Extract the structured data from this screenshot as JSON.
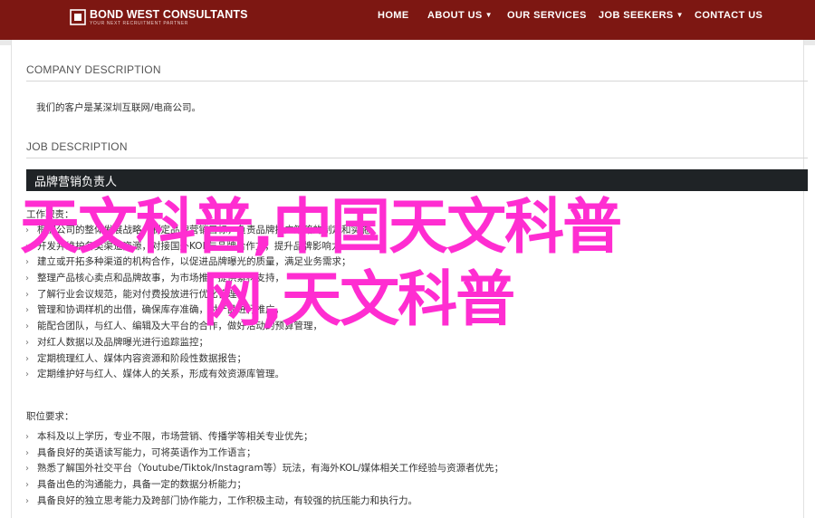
{
  "header": {
    "brand_name": "BOND WEST CONSULTANTS",
    "brand_tagline": "YOUR NEXT RECRUITMENT PARTNER",
    "nav": [
      {
        "label": "HOME",
        "dropdown": false
      },
      {
        "label": "ABOUT US",
        "dropdown": true
      },
      {
        "label": "OUR SERVICES",
        "dropdown": false
      },
      {
        "label": "JOB SEEKERS",
        "dropdown": true
      },
      {
        "label": "CONTACT US",
        "dropdown": false
      }
    ]
  },
  "company": {
    "heading": "COMPANY DESCRIPTION",
    "text": "我们的客户是某深圳互联网/电商公司。"
  },
  "job": {
    "heading": "JOB DESCRIPTION",
    "title": "品牌营销负责人",
    "duties_heading": "工作职责：",
    "duties": [
      "根据公司的整体发展战略，制定品牌营销目标，负责品牌推广策略的制定和实施",
      "开发并维护各类渠道资源，对接国外KOL与品牌合作方，提升品牌影响力",
      "建立或开拓多种渠道的机构合作，以促进品牌曝光的质量，满足业务需求；",
      "整理产品核心卖点和品牌故事，为市场推广提供素材支持，",
      "了解行业会议规范，能对付费投放进行优化管理，",
      "管理和协调样机的出借，确保库存准确，对产品进行推广，",
      "能配合团队，与红人、编辑及大平台的合作，做好活动的预算管理，",
      "对红人数据以及品牌曝光进行追踪监控；",
      "定期梳理红人、媒体内容资源和阶段性数据报告；",
      "定期维护好与红人、媒体人的关系，形成有效资源库管理。"
    ],
    "requirements_heading": "职位要求：",
    "requirements": [
      "本科及以上学历，专业不限，市场营销、传播学等相关专业优先；",
      "具备良好的英语读写能力，可将英语作为工作语言；",
      "熟悉了解国外社交平台（Youtube/Tiktok/Instagram等）玩法，有海外KOL/媒体相关工作经验与资源者优先；",
      "具备出色的沟通能力，具备一定的数据分析能力；",
      "具备良好的独立思考能力及跨部门协作能力，工作积极主动，有较强的抗压能力和执行力。"
    ]
  },
  "watermark": {
    "line1": "天文科普,中国天文科普",
    "line2": "网,天文科普",
    "color": "#ff2dd1"
  },
  "colors": {
    "header_bg": "#7d1712",
    "job_bar_bg": "#1f2326",
    "watermark": "#ff2dd1"
  }
}
